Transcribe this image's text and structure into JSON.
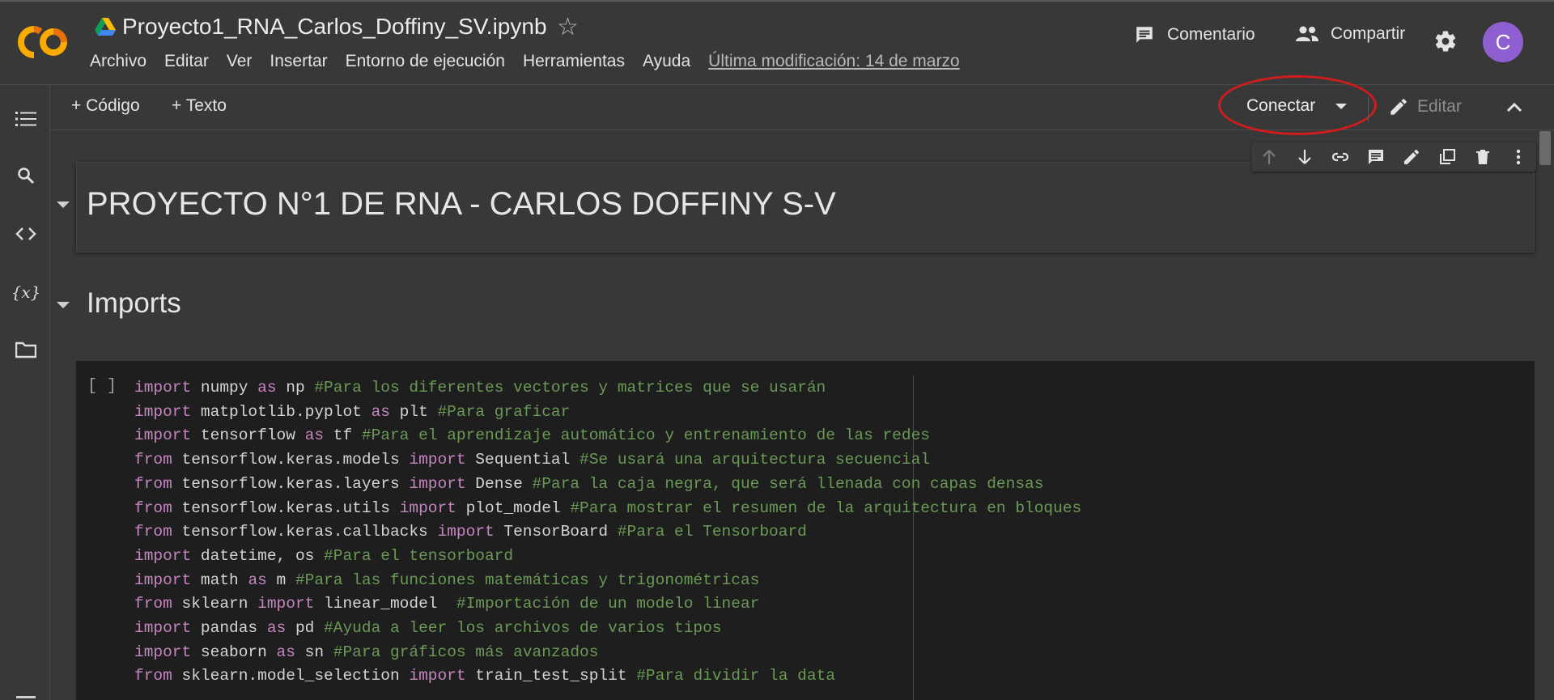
{
  "header": {
    "title": "Proyecto1_RNA_Carlos_Doffiny_SV.ipynb",
    "menus": [
      "Archivo",
      "Editar",
      "Ver",
      "Insertar",
      "Entorno de ejecución",
      "Herramientas",
      "Ayuda"
    ],
    "last_modified": "Última modificación: 14 de marzo",
    "comment_label": "Comentario",
    "share_label": "Compartir",
    "avatar_letter": "C"
  },
  "toolbar": {
    "add_code": "+ Código",
    "add_text": "+ Texto",
    "connect": "Conectar",
    "edit": "Editar"
  },
  "cells": {
    "heading1": "PROYECTO N°1 DE RNA - CARLOS DOFFINY S-V",
    "heading2": "Imports",
    "run_indicator": "[ ]"
  },
  "colors": {
    "accent_avatar": "#8e5fd0",
    "keyword": "#c586c0",
    "comment": "#6a9955",
    "annotation_ellipse": "#d01c1c"
  },
  "code_lines": [
    [
      {
        "t": "import",
        "k": "kw"
      },
      {
        "t": " numpy "
      },
      {
        "t": "as",
        "k": "kw"
      },
      {
        "t": " np "
      },
      {
        "t": "#Para los diferentes vectores y matrices que se usarán",
        "k": "cm"
      }
    ],
    [
      {
        "t": "import",
        "k": "kw"
      },
      {
        "t": " matplotlib.pyplot "
      },
      {
        "t": "as",
        "k": "kw"
      },
      {
        "t": " plt "
      },
      {
        "t": "#Para graficar",
        "k": "cm"
      }
    ],
    [
      {
        "t": "import",
        "k": "kw"
      },
      {
        "t": " tensorflow "
      },
      {
        "t": "as",
        "k": "kw"
      },
      {
        "t": " tf "
      },
      {
        "t": "#Para el aprendizaje automático y entrenamiento de las redes",
        "k": "cm"
      }
    ],
    [
      {
        "t": "from",
        "k": "kw"
      },
      {
        "t": " tensorflow.keras.models "
      },
      {
        "t": "import",
        "k": "kw"
      },
      {
        "t": " Sequential "
      },
      {
        "t": "#Se usará una arquitectura secuencial",
        "k": "cm"
      }
    ],
    [
      {
        "t": "from",
        "k": "kw"
      },
      {
        "t": " tensorflow.keras.layers "
      },
      {
        "t": "import",
        "k": "kw"
      },
      {
        "t": " Dense "
      },
      {
        "t": "#Para la caja negra, que será llenada con capas densas",
        "k": "cm"
      }
    ],
    [
      {
        "t": "from",
        "k": "kw"
      },
      {
        "t": " tensorflow.keras.utils "
      },
      {
        "t": "import",
        "k": "kw"
      },
      {
        "t": " plot_model "
      },
      {
        "t": "#Para mostrar el resumen de la arquitectura en bloques",
        "k": "cm"
      }
    ],
    [
      {
        "t": "from",
        "k": "kw"
      },
      {
        "t": " tensorflow.keras.callbacks "
      },
      {
        "t": "import",
        "k": "kw"
      },
      {
        "t": " TensorBoard "
      },
      {
        "t": "#Para el Tensorboard",
        "k": "cm"
      }
    ],
    [
      {
        "t": "import",
        "k": "kw"
      },
      {
        "t": " datetime, os "
      },
      {
        "t": "#Para el tensorboard",
        "k": "cm"
      }
    ],
    [
      {
        "t": "import",
        "k": "kw"
      },
      {
        "t": " math "
      },
      {
        "t": "as",
        "k": "kw"
      },
      {
        "t": " m "
      },
      {
        "t": "#Para las funciones matemáticas y trigonométricas",
        "k": "cm"
      }
    ],
    [
      {
        "t": "from",
        "k": "kw"
      },
      {
        "t": " sklearn "
      },
      {
        "t": "import",
        "k": "kw"
      },
      {
        "t": " linear_model  "
      },
      {
        "t": "#Importación de un modelo linear",
        "k": "cm"
      }
    ],
    [
      {
        "t": "import",
        "k": "kw"
      },
      {
        "t": " pandas "
      },
      {
        "t": "as",
        "k": "kw"
      },
      {
        "t": " pd "
      },
      {
        "t": "#Ayuda a leer los archivos de varios tipos",
        "k": "cm"
      }
    ],
    [
      {
        "t": "import",
        "k": "kw"
      },
      {
        "t": " seaborn "
      },
      {
        "t": "as",
        "k": "kw"
      },
      {
        "t": " sn "
      },
      {
        "t": "#Para gráficos más avanzados",
        "k": "cm"
      }
    ],
    [
      {
        "t": "from",
        "k": "kw"
      },
      {
        "t": " sklearn.model_selection "
      },
      {
        "t": "import",
        "k": "kw"
      },
      {
        "t": " train_test_split "
      },
      {
        "t": "#Para dividir la data",
        "k": "cm"
      }
    ]
  ]
}
